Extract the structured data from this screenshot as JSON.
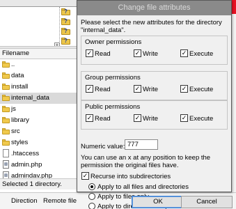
{
  "background": {
    "tabs": [
      "",
      ""
    ],
    "file_list_header": "Filename",
    "files": [
      {
        "name": "..",
        "type": "folder",
        "selected": false
      },
      {
        "name": "data",
        "type": "folder",
        "selected": false
      },
      {
        "name": "install",
        "type": "folder",
        "selected": false
      },
      {
        "name": "internal_data",
        "type": "folder",
        "selected": true
      },
      {
        "name": "js",
        "type": "folder",
        "selected": false
      },
      {
        "name": "library",
        "type": "folder",
        "selected": false
      },
      {
        "name": "src",
        "type": "folder",
        "selected": false
      },
      {
        "name": "styles",
        "type": "folder",
        "selected": false
      },
      {
        "name": ".htaccess",
        "type": "file",
        "selected": false
      },
      {
        "name": "admin.php",
        "type": "php",
        "selected": false
      },
      {
        "name": "admindav.php",
        "type": "php",
        "selected": false
      }
    ],
    "status_text": "Selected 1 directory.",
    "queue_columns": [
      "Direction",
      "Remote file"
    ],
    "close_glyph": "✕"
  },
  "dialog": {
    "title": "Change file attributes",
    "intro": "Please select the new attributes for the directory \"internal_data\".",
    "groups": [
      {
        "label": "Owner permissions",
        "read": "Read",
        "write": "Write",
        "execute": "Execute",
        "read_checked": true,
        "write_checked": true,
        "execute_checked": true
      },
      {
        "label": "Group permissions",
        "read": "Read",
        "write": "Write",
        "execute": "Execute",
        "read_checked": true,
        "write_checked": true,
        "execute_checked": true
      },
      {
        "label": "Public permissions",
        "read": "Read",
        "write": "Write",
        "execute": "Execute",
        "read_checked": true,
        "write_checked": true,
        "execute_checked": true
      }
    ],
    "numeric_label": "Numeric value:",
    "numeric_value": "777",
    "hint": "You can use an x at any position to keep the permission the original files have.",
    "recurse_label": "Recurse into subdirectories",
    "recurse_checked": true,
    "radio_options": [
      {
        "label": "Apply to all files and directories",
        "selected": true
      },
      {
        "label": "Apply to files only",
        "selected": false
      },
      {
        "label": "Apply to directories only",
        "selected": false
      }
    ],
    "ok_label": "OK",
    "cancel_label": "Cancel",
    "check_glyph": "✓",
    "colors": {
      "titlebar": "#8a8a8a",
      "selected_row": "#dadada",
      "close_button": "#e81123",
      "default_button_border": "#3c7fd1"
    }
  }
}
